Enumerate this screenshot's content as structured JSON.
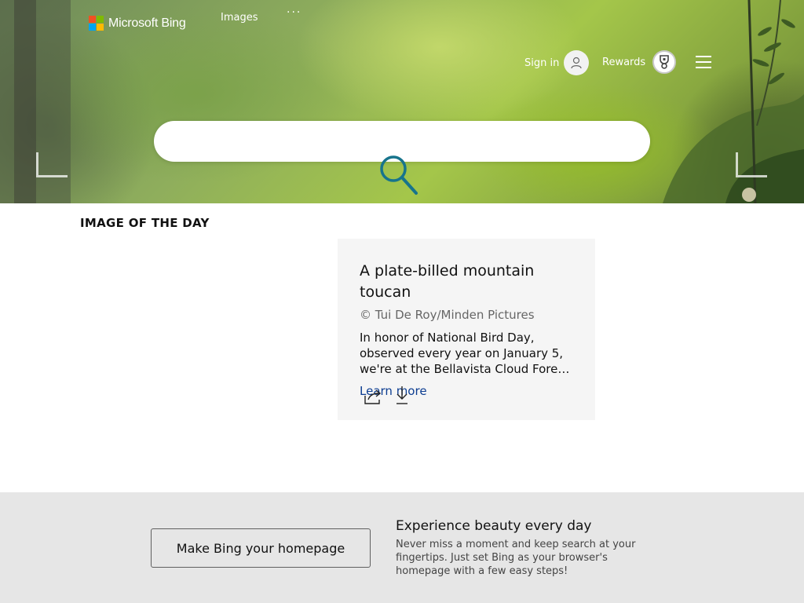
{
  "header": {
    "brand": "Microsoft Bing",
    "nav_images": "Images",
    "nav_more": "···",
    "sign_in": "Sign in",
    "rewards": "Rewards"
  },
  "search": {
    "value": "",
    "placeholder": ""
  },
  "iotd": {
    "heading": "IMAGE OF THE DAY",
    "title": "A plate-billed mountain toucan",
    "credit": "© Tui De Roy/Minden Pictures",
    "description": "In honor of National Bird Day, observed every year on January 5, we're at the Bellavista Cloud Forest Reserve in Ecuador, home to this plate-billed mountain toucan.",
    "learn_more": "Learn more"
  },
  "banner": {
    "button_label": "Make Bing your homepage",
    "title": "Experience beauty every day",
    "subtitle": "Never miss a moment and keep search at your fingertips. Just set Bing as your browser's homepage with a few easy steps!"
  },
  "colors": {
    "ms_red": "#f25022",
    "ms_green": "#7fba00",
    "ms_blue": "#00a4ef",
    "ms_yellow": "#ffb900",
    "search_icon": "#17748c",
    "link": "#0c3d91",
    "banner_bg": "#e6e6e6",
    "card_bg": "#f5f5f5"
  },
  "icons": {
    "avatar": "person-icon",
    "rewards": "trophy-icon",
    "menu": "hamburger-icon",
    "search": "search-icon",
    "share": "share-icon",
    "download": "download-icon"
  }
}
